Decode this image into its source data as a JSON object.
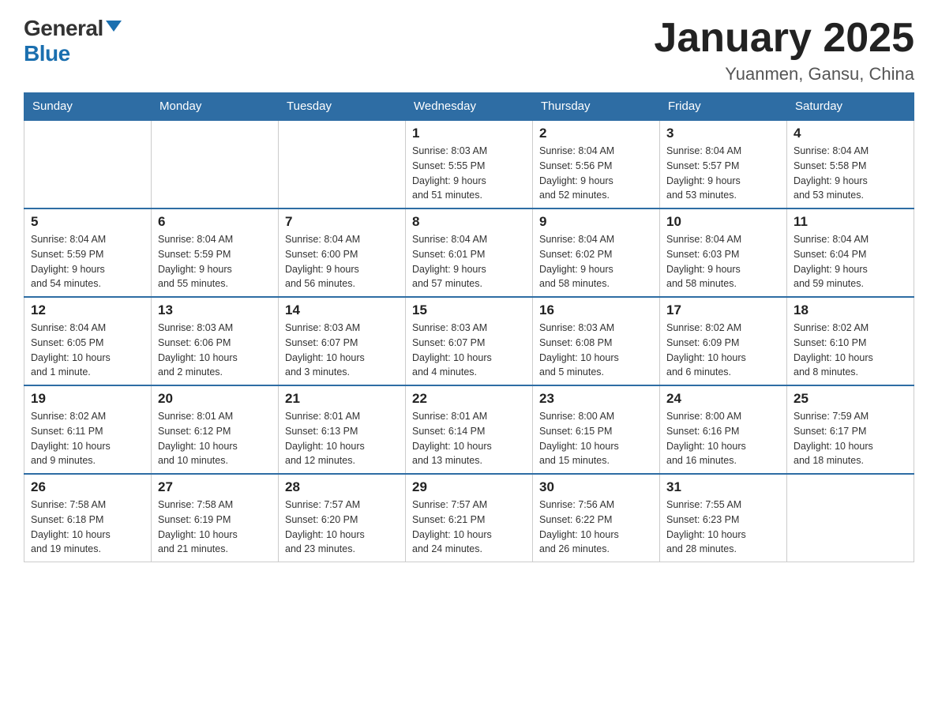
{
  "header": {
    "logo_general": "General",
    "logo_blue": "Blue",
    "title": "January 2025",
    "subtitle": "Yuanmen, Gansu, China"
  },
  "days_of_week": [
    "Sunday",
    "Monday",
    "Tuesday",
    "Wednesday",
    "Thursday",
    "Friday",
    "Saturday"
  ],
  "weeks": [
    [
      {
        "day": "",
        "info": ""
      },
      {
        "day": "",
        "info": ""
      },
      {
        "day": "",
        "info": ""
      },
      {
        "day": "1",
        "info": "Sunrise: 8:03 AM\nSunset: 5:55 PM\nDaylight: 9 hours\nand 51 minutes."
      },
      {
        "day": "2",
        "info": "Sunrise: 8:04 AM\nSunset: 5:56 PM\nDaylight: 9 hours\nand 52 minutes."
      },
      {
        "day": "3",
        "info": "Sunrise: 8:04 AM\nSunset: 5:57 PM\nDaylight: 9 hours\nand 53 minutes."
      },
      {
        "day": "4",
        "info": "Sunrise: 8:04 AM\nSunset: 5:58 PM\nDaylight: 9 hours\nand 53 minutes."
      }
    ],
    [
      {
        "day": "5",
        "info": "Sunrise: 8:04 AM\nSunset: 5:59 PM\nDaylight: 9 hours\nand 54 minutes."
      },
      {
        "day": "6",
        "info": "Sunrise: 8:04 AM\nSunset: 5:59 PM\nDaylight: 9 hours\nand 55 minutes."
      },
      {
        "day": "7",
        "info": "Sunrise: 8:04 AM\nSunset: 6:00 PM\nDaylight: 9 hours\nand 56 minutes."
      },
      {
        "day": "8",
        "info": "Sunrise: 8:04 AM\nSunset: 6:01 PM\nDaylight: 9 hours\nand 57 minutes."
      },
      {
        "day": "9",
        "info": "Sunrise: 8:04 AM\nSunset: 6:02 PM\nDaylight: 9 hours\nand 58 minutes."
      },
      {
        "day": "10",
        "info": "Sunrise: 8:04 AM\nSunset: 6:03 PM\nDaylight: 9 hours\nand 58 minutes."
      },
      {
        "day": "11",
        "info": "Sunrise: 8:04 AM\nSunset: 6:04 PM\nDaylight: 9 hours\nand 59 minutes."
      }
    ],
    [
      {
        "day": "12",
        "info": "Sunrise: 8:04 AM\nSunset: 6:05 PM\nDaylight: 10 hours\nand 1 minute."
      },
      {
        "day": "13",
        "info": "Sunrise: 8:03 AM\nSunset: 6:06 PM\nDaylight: 10 hours\nand 2 minutes."
      },
      {
        "day": "14",
        "info": "Sunrise: 8:03 AM\nSunset: 6:07 PM\nDaylight: 10 hours\nand 3 minutes."
      },
      {
        "day": "15",
        "info": "Sunrise: 8:03 AM\nSunset: 6:07 PM\nDaylight: 10 hours\nand 4 minutes."
      },
      {
        "day": "16",
        "info": "Sunrise: 8:03 AM\nSunset: 6:08 PM\nDaylight: 10 hours\nand 5 minutes."
      },
      {
        "day": "17",
        "info": "Sunrise: 8:02 AM\nSunset: 6:09 PM\nDaylight: 10 hours\nand 6 minutes."
      },
      {
        "day": "18",
        "info": "Sunrise: 8:02 AM\nSunset: 6:10 PM\nDaylight: 10 hours\nand 8 minutes."
      }
    ],
    [
      {
        "day": "19",
        "info": "Sunrise: 8:02 AM\nSunset: 6:11 PM\nDaylight: 10 hours\nand 9 minutes."
      },
      {
        "day": "20",
        "info": "Sunrise: 8:01 AM\nSunset: 6:12 PM\nDaylight: 10 hours\nand 10 minutes."
      },
      {
        "day": "21",
        "info": "Sunrise: 8:01 AM\nSunset: 6:13 PM\nDaylight: 10 hours\nand 12 minutes."
      },
      {
        "day": "22",
        "info": "Sunrise: 8:01 AM\nSunset: 6:14 PM\nDaylight: 10 hours\nand 13 minutes."
      },
      {
        "day": "23",
        "info": "Sunrise: 8:00 AM\nSunset: 6:15 PM\nDaylight: 10 hours\nand 15 minutes."
      },
      {
        "day": "24",
        "info": "Sunrise: 8:00 AM\nSunset: 6:16 PM\nDaylight: 10 hours\nand 16 minutes."
      },
      {
        "day": "25",
        "info": "Sunrise: 7:59 AM\nSunset: 6:17 PM\nDaylight: 10 hours\nand 18 minutes."
      }
    ],
    [
      {
        "day": "26",
        "info": "Sunrise: 7:58 AM\nSunset: 6:18 PM\nDaylight: 10 hours\nand 19 minutes."
      },
      {
        "day": "27",
        "info": "Sunrise: 7:58 AM\nSunset: 6:19 PM\nDaylight: 10 hours\nand 21 minutes."
      },
      {
        "day": "28",
        "info": "Sunrise: 7:57 AM\nSunset: 6:20 PM\nDaylight: 10 hours\nand 23 minutes."
      },
      {
        "day": "29",
        "info": "Sunrise: 7:57 AM\nSunset: 6:21 PM\nDaylight: 10 hours\nand 24 minutes."
      },
      {
        "day": "30",
        "info": "Sunrise: 7:56 AM\nSunset: 6:22 PM\nDaylight: 10 hours\nand 26 minutes."
      },
      {
        "day": "31",
        "info": "Sunrise: 7:55 AM\nSunset: 6:23 PM\nDaylight: 10 hours\nand 28 minutes."
      },
      {
        "day": "",
        "info": ""
      }
    ]
  ]
}
